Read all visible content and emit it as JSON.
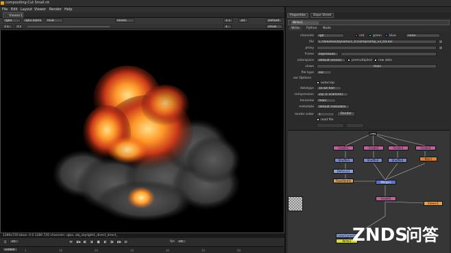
{
  "window": {
    "title": "compositing-Cut Small.nk"
  },
  "menubar": [
    "File",
    "Edit",
    "Layout",
    "Viewer",
    "Render",
    "Help"
  ],
  "viewer": {
    "tab_label": "Viewer1",
    "toolbar": {
      "channels": "rgba",
      "channel_alpha": "rgba.alpha",
      "colorspace": "RGB",
      "a_input": "Read1",
      "zoom": "1:1",
      "proxy": "2D",
      "lut": "Default",
      "gain_label": "f 1",
      "y_field": "Y 1",
      "gamma_label": "1",
      "frame_field": "sRGB"
    },
    "status_line": "1280x720  bbox: 0 0 1280 720 channels: rgba, obj_skylight1_direct_direct_",
    "playback": {
      "frame": "25",
      "fps_label": "fps",
      "fps": "24",
      "global_label": "Global"
    },
    "timeline_ticks": [
      "1",
      "10",
      "20",
      "30",
      "40",
      "50",
      "60"
    ]
  },
  "properties": {
    "panel_tabs": [
      "Properties",
      "Dope Sheet"
    ],
    "node_name": "Write1",
    "subtabs": [
      "Write",
      "Python",
      "Node"
    ],
    "channels": {
      "label": "channels",
      "value": "rgb",
      "red": "red",
      "green": "green",
      "blue": "blue",
      "extra": "none"
    },
    "file": {
      "label": "file",
      "value": "C:/Volumes/Dynamics_V:/comp/comp_v3_hd.exr"
    },
    "proxy": {
      "label": "proxy"
    },
    "frame": {
      "label": "frame",
      "value": "expression"
    },
    "colorspace": {
      "label": "colorspace",
      "value": "default (linear)",
      "premultiplied": "premultiplied",
      "raw_data": "raw data"
    },
    "views": {
      "label": "views",
      "value": "main"
    },
    "file_type": {
      "label": "file type",
      "value": "exr"
    },
    "exr_options": "exr Options",
    "autocrop": "autocrop",
    "datatype": {
      "label": "datatype",
      "value": "16 bit half"
    },
    "compression": {
      "label": "compression",
      "value": "Zip (1 scanline)"
    },
    "heroview": {
      "label": "heroview",
      "value": "main"
    },
    "metadata": {
      "label": "metadata",
      "value": "default metadata"
    },
    "render_order": {
      "label": "render order",
      "value": "1"
    },
    "render_button": "Render",
    "read_file": "read file"
  },
  "nodegraph": {
    "nodes": [
      {
        "label": "Grade1",
        "color": "#c0609a"
      },
      {
        "label": "Grade2",
        "color": "#c0609a"
      },
      {
        "label": "Grade3",
        "color": "#c0609a"
      },
      {
        "label": "Grade4",
        "color": "#c0609a"
      },
      {
        "label": "Shuffle1",
        "color": "#7a86c8"
      },
      {
        "label": "Shuffle2",
        "color": "#7a86c8"
      },
      {
        "label": "Shuffle3",
        "color": "#7a86c8"
      },
      {
        "label": "Blur1",
        "color": "#e08040"
      },
      {
        "label": "Defocus1",
        "color": "#8aa0d0"
      },
      {
        "label": "Transform1",
        "color": "#d0a060"
      },
      {
        "label": "Merge1",
        "color": "#5a70d0"
      },
      {
        "label": "Grade5",
        "color": "#c0609a"
      },
      {
        "label": "Viewer1",
        "color": "#e0a050"
      },
      {
        "label": "Write1",
        "color": "#d8d840"
      },
      {
        "label": "ColorCorrect1",
        "color": "#8aa0d0"
      }
    ]
  },
  "watermark": {
    "brand": "ZNDS",
    "suffix": "问答"
  }
}
